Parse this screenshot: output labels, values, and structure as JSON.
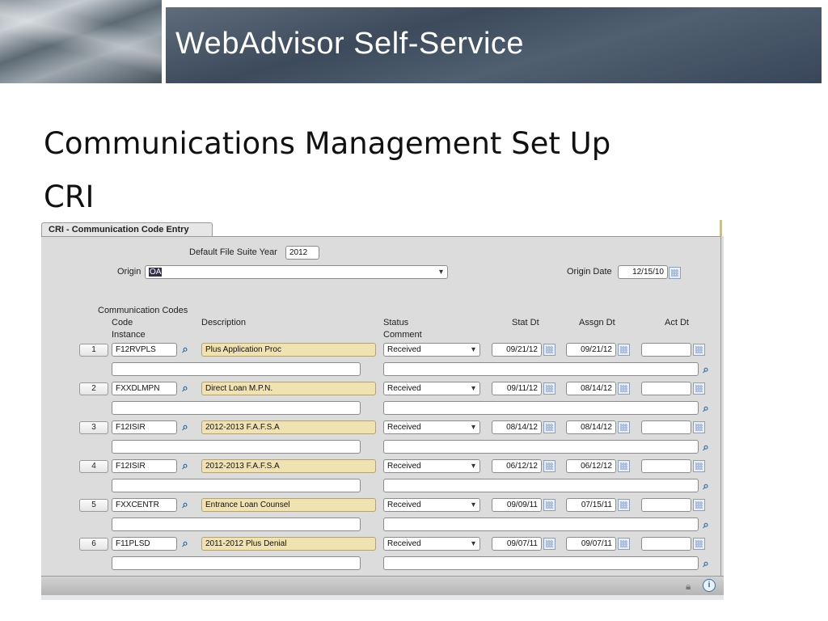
{
  "header": {
    "title": "WebAdvisor Self-Service"
  },
  "slide": {
    "title_line1": "Communications Management Set Up",
    "title_line2": "CRI"
  },
  "form": {
    "tab_label": "CRI - Communication Code Entry",
    "default_file_suite_year_label": "Default File Suite Year",
    "default_file_suite_year_value": "2012",
    "origin_label": "Origin",
    "origin_value": "OA",
    "origin_date_label": "Origin Date",
    "origin_date_value": "12/15/10",
    "columns": {
      "comm_codes": "Communication Codes",
      "code": "Code",
      "instance": "Instance",
      "description": "Description",
      "status": "Status",
      "comment": "Comment",
      "stat_dt": "Stat Dt",
      "assgn_dt": "Assgn Dt",
      "act_dt": "Act Dt"
    },
    "rows": [
      {
        "num": "1",
        "code": "F12RVPLS",
        "description": "Plus Application Proc",
        "status": "Received",
        "stat_dt": "09/21/12",
        "assgn_dt": "09/21/12",
        "act_dt": "",
        "instance": "",
        "comment": ""
      },
      {
        "num": "2",
        "code": "FXXDLMPN",
        "description": "Direct Loan M.P.N.",
        "status": "Received",
        "stat_dt": "09/11/12",
        "assgn_dt": "08/14/12",
        "act_dt": "",
        "instance": "",
        "comment": ""
      },
      {
        "num": "3",
        "code": "F12ISIR",
        "description": "2012-2013 F.A.F.S.A",
        "status": "Received",
        "stat_dt": "08/14/12",
        "assgn_dt": "08/14/12",
        "act_dt": "",
        "instance": "",
        "comment": ""
      },
      {
        "num": "4",
        "code": "F12ISIR",
        "description": "2012-2013 F.A.F.S.A",
        "status": "Received",
        "stat_dt": "06/12/12",
        "assgn_dt": "06/12/12",
        "act_dt": "",
        "instance": "",
        "comment": ""
      },
      {
        "num": "5",
        "code": "FXXCENTR",
        "description": "Entrance Loan Counsel",
        "status": "Received",
        "stat_dt": "09/09/11",
        "assgn_dt": "07/15/11",
        "act_dt": "",
        "instance": "",
        "comment": ""
      },
      {
        "num": "6",
        "code": "F11PLSD",
        "description": "2011-2012 Plus Denial",
        "status": "Received",
        "stat_dt": "09/07/11",
        "assgn_dt": "09/07/11",
        "act_dt": "",
        "instance": "",
        "comment": ""
      }
    ]
  }
}
